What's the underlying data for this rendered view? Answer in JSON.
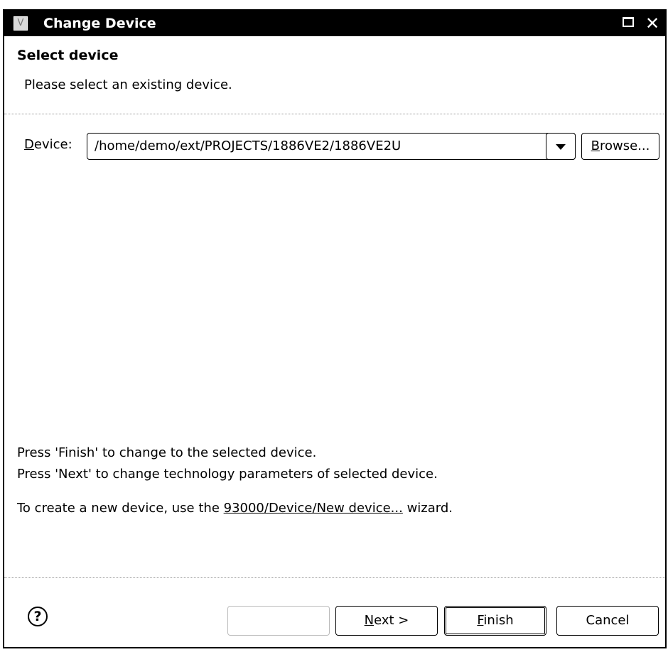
{
  "window": {
    "title": "Change Device",
    "app_icon_letter": "V",
    "maximize_icon": "maximize-icon",
    "close_glyph": "✕"
  },
  "page": {
    "section_title": "Select device",
    "subtitle": "Please select an existing device."
  },
  "device": {
    "label": "Device:",
    "label_mnemonic": "D",
    "label_rest": "evice:",
    "value": "/home/demo/ext/PROJECTS/1886VE2/1886VE2U",
    "browse_mnemonic": "B",
    "browse_rest": "rowse..."
  },
  "info": {
    "line1": "Press 'Finish' to change to the selected device.",
    "line2": "Press 'Next' to change technology parameters of selected device.",
    "line3_prefix": "To create a new device, use the ",
    "line3_link": "93000/Device/New device...",
    "line3_suffix": " wizard."
  },
  "buttons": {
    "help_glyph": "?",
    "back_label": "",
    "next_mnemonic": "N",
    "next_rest": "ext >",
    "finish_mnemonic": "F",
    "finish_rest": "inish",
    "cancel": "Cancel"
  }
}
